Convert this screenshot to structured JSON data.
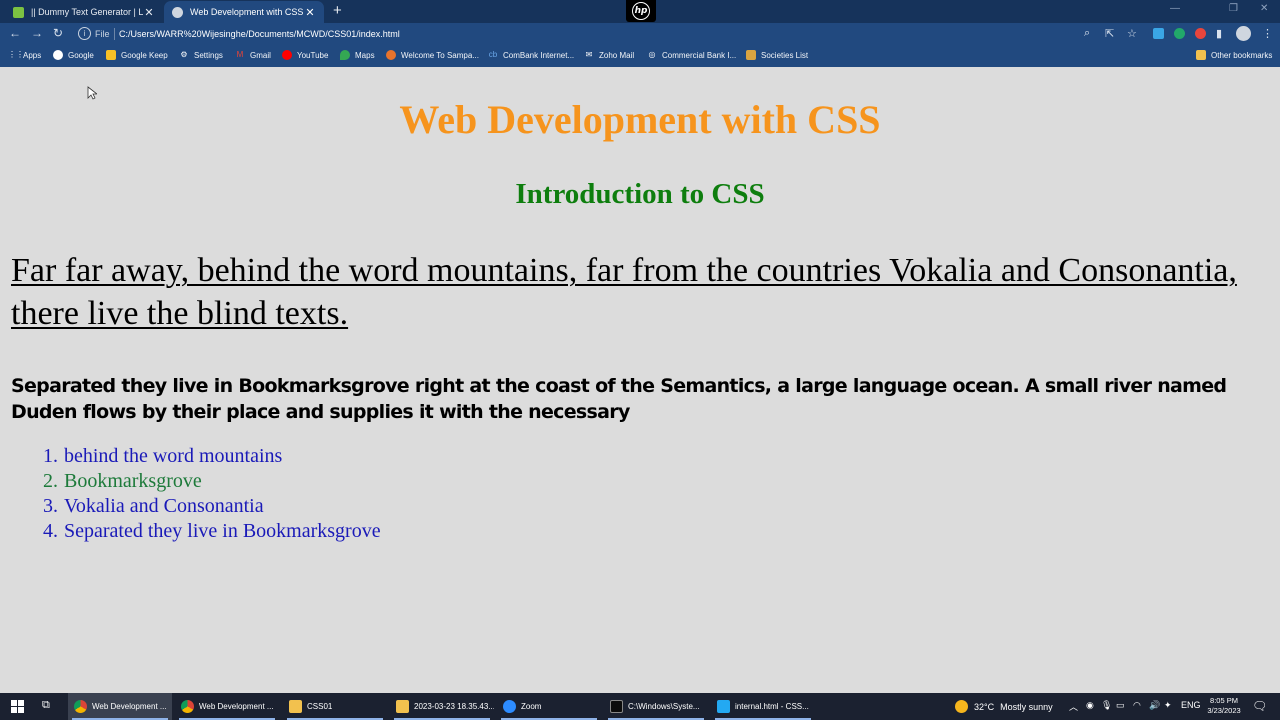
{
  "browser": {
    "tabs": [
      {
        "title": "|| Dummy Text Generator | Lorem Ipsum"
      },
      {
        "title": "Web Development with CSS"
      }
    ],
    "new_tab": "+",
    "hp_logo": "hp",
    "address": {
      "scheme_label": "File",
      "url": "C:/Users/WARR%20Wijesinghe/Documents/MCWD/CSS01/index.html"
    },
    "bookmarks": [
      {
        "label": "Apps",
        "icon": "apps-grid-icon",
        "color": "#ffffff"
      },
      {
        "label": "Google",
        "icon": "google-icon",
        "color": "#ffffff"
      },
      {
        "label": "Google Keep",
        "icon": "keep-icon",
        "color": "#f6c026"
      },
      {
        "label": "Settings",
        "icon": "gear-icon",
        "color": "#ffffff"
      },
      {
        "label": "Gmail",
        "icon": "gmail-icon",
        "color": "#ea4335"
      },
      {
        "label": "YouTube",
        "icon": "youtube-icon",
        "color": "#ff0000"
      },
      {
        "label": "Maps",
        "icon": "maps-icon",
        "color": "#34a853"
      },
      {
        "label": "Welcome To Sampa...",
        "icon": "sampath-icon",
        "color": "#e8732c"
      },
      {
        "label": "ComBank Internet...",
        "icon": "combank-icon",
        "color": "#2b7bd6"
      },
      {
        "label": "Zoho Mail",
        "icon": "zoho-icon",
        "color": "#ffffff"
      },
      {
        "label": "Commercial Bank I...",
        "icon": "globe-icon",
        "color": "#ffffff"
      },
      {
        "label": "Societies List",
        "icon": "societies-icon",
        "color": "#d9a441"
      }
    ],
    "other_bookmarks": "Other bookmarks"
  },
  "page": {
    "heading": "Web Development with CSS",
    "subheading": "Introduction to CSS",
    "lead": "Far far away, behind the word mountains, far from the countries Vokalia and Consonantia, there live the blind texts.",
    "paragraph": "Separated they live in Bookmarksgrove right at the coast of the Semantics, a large language ocean. A small river named Duden flows by their place and supplies it with the necessary",
    "list": [
      {
        "num": "1.",
        "text": "behind the word mountains",
        "color": "#1a1ab8"
      },
      {
        "num": "2.",
        "text": "Bookmarksgrove",
        "color": "#1d7a3a"
      },
      {
        "num": "3.",
        "text": "Vokalia and Consonantia",
        "color": "#1a1ab8"
      },
      {
        "num": "4.",
        "text": "Separated they live in Bookmarksgrove",
        "color": "#1a1ab8"
      }
    ],
    "colors": {
      "heading": "#f6941d",
      "subheading": "#0e7e0e",
      "background": "#dcdcdc"
    }
  },
  "taskbar": {
    "apps": [
      {
        "label": "Web Development ...",
        "icon": "chrome-icon",
        "active": true
      },
      {
        "label": "Web Development ...",
        "icon": "chrome-icon",
        "active": false
      },
      {
        "label": "CSS01",
        "icon": "folder-icon",
        "active": false
      },
      {
        "label": "2023-03-23 18.35.43...",
        "icon": "folder-icon",
        "active": false
      },
      {
        "label": "Zoom",
        "icon": "zoom-icon",
        "active": false
      },
      {
        "label": "C:\\Windows\\Syste...",
        "icon": "terminal-icon",
        "active": false
      },
      {
        "label": "internal.html - CSS...",
        "icon": "vscode-icon",
        "active": false
      }
    ],
    "weather": {
      "temp": "32°C",
      "condition": "Mostly sunny"
    },
    "language": "ENG",
    "time": "8:05 PM",
    "date": "3/23/2023"
  }
}
